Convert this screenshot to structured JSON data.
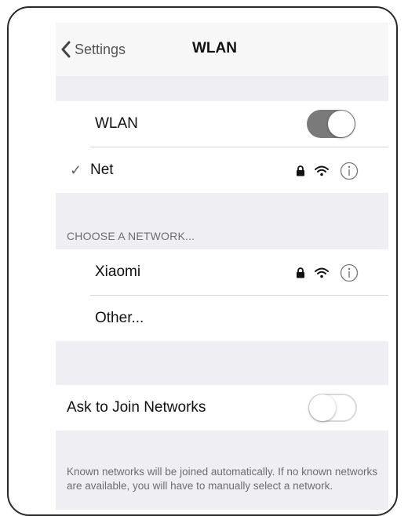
{
  "nav": {
    "back_label": "Settings",
    "title": "WLAN"
  },
  "wlan": {
    "label": "WLAN",
    "enabled": true
  },
  "connected": {
    "name": "Net",
    "checkmark": "✓"
  },
  "section_header": "CHOOSE A NETWORK...",
  "networks": [
    {
      "name": "Xiaomi",
      "secured": true
    },
    {
      "name": "Other...",
      "secured": false
    }
  ],
  "ask_to_join": {
    "label": "Ask to Join Networks",
    "enabled": false
  },
  "footer_text": "Known networks will be joined automatically. If no known networks are available, you will have to manually select a network.",
  "icons": [
    "chevron-left-icon",
    "checkmark-icon",
    "lock-icon",
    "wifi-icon",
    "info-icon"
  ],
  "colors": {
    "toggle_on": "#7a7a7a",
    "group_bg": "#efeff3"
  }
}
